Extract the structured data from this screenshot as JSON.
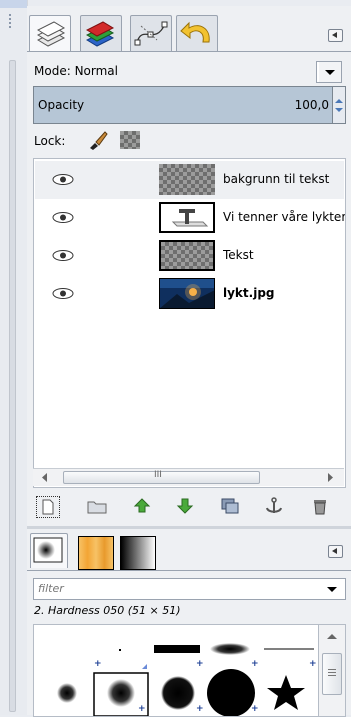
{
  "layers_dock": {
    "tabs": [
      "layers-icon",
      "channels-icon",
      "paths-icon",
      "undo-history-icon"
    ],
    "mode": {
      "label": "Mode:",
      "value": "Normal"
    },
    "opacity": {
      "label": "Opacity",
      "value": "100,0"
    },
    "lock": {
      "label": "Lock:",
      "icons": [
        "paintbrush-icon",
        "alpha-checker-icon"
      ]
    },
    "layers": [
      {
        "name": "bakgrunn til tekst",
        "visible": true,
        "thumbnail": "transparent-checker",
        "bold": false
      },
      {
        "name": "Vi tenner våre lykter",
        "visible": true,
        "thumbnail": "text-layer",
        "bold": false
      },
      {
        "name": "Tekst",
        "visible": true,
        "thumbnail": "transparent-checker",
        "bold": false
      },
      {
        "name": "lykt.jpg",
        "visible": true,
        "thumbnail": "photo",
        "bold": true
      }
    ],
    "scrollbar": {
      "thumb_grip": "III"
    },
    "buttons": [
      "new-layer-icon",
      "new-group-icon",
      "raise-layer-icon",
      "lower-layer-icon",
      "duplicate-layer-icon",
      "anchor-layer-icon",
      "delete-layer-icon"
    ]
  },
  "brushes_dock": {
    "tabs": [
      "brushes-icon",
      "patterns-icon",
      "gradients-icon"
    ],
    "filter_placeholder": "filter",
    "selected_brush": "2. Hardness 050 (51 × 51)"
  },
  "colors": {
    "selection": "#b6c6d6",
    "accent_blue": "#1c3f94"
  }
}
